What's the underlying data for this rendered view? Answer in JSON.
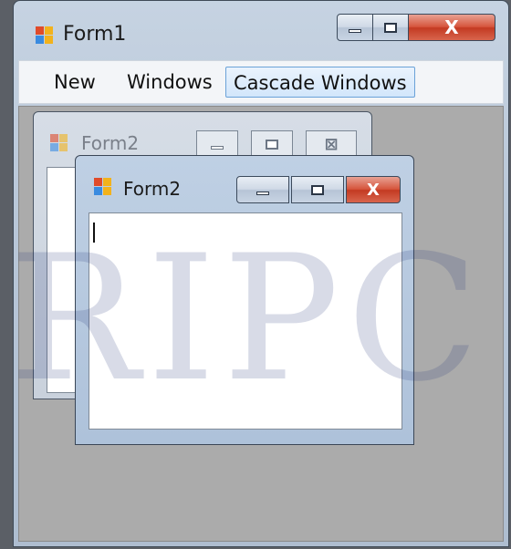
{
  "main_window": {
    "title": "Form1",
    "icon": "form-icon",
    "caption_buttons": [
      "minimize-icon",
      "maximize-icon",
      "close-icon"
    ],
    "close_glyph": "X"
  },
  "menu": {
    "items": [
      {
        "label": "New"
      },
      {
        "label": "Windows"
      },
      {
        "label": "Cascade Windows",
        "active": true
      }
    ]
  },
  "child_windows": [
    {
      "title": "Form2",
      "state": "inactive",
      "close_glyph": "⊠"
    },
    {
      "title": "Form2",
      "state": "active",
      "close_glyph": "X",
      "textbox_value": ""
    }
  ],
  "watermark": "RIPC",
  "colors": {
    "close_active": "#c33a22",
    "menu_highlight": "#6ba2d8",
    "mdi_background": "#ababab"
  }
}
